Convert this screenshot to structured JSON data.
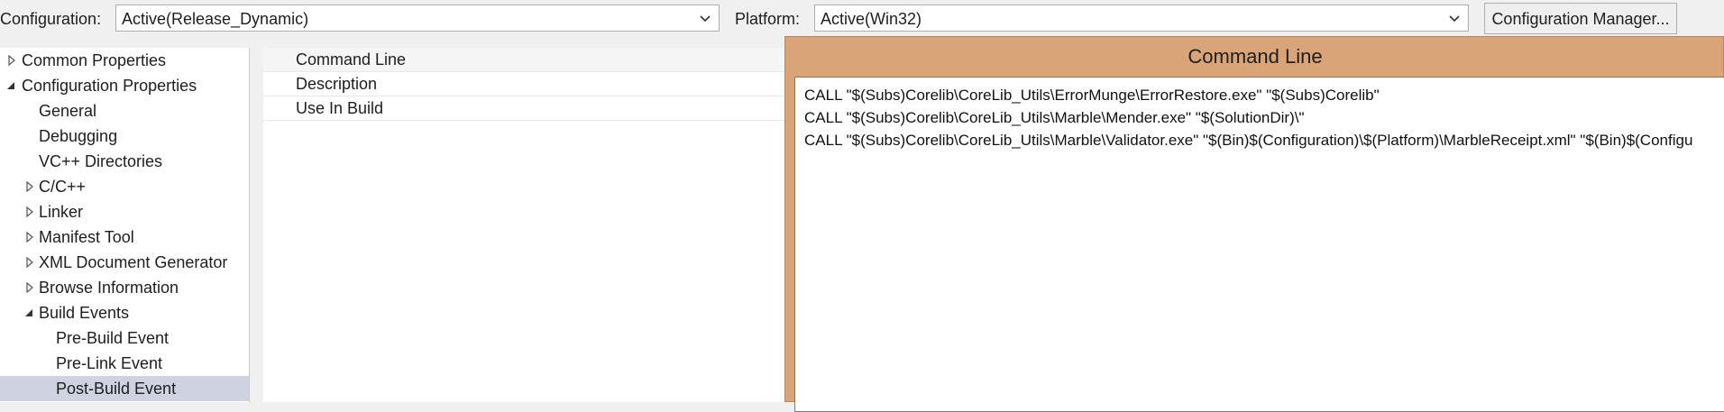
{
  "toolbar": {
    "configuration_label": "Configuration:",
    "configuration_value": "Active(Release_Dynamic)",
    "platform_label": "Platform:",
    "platform_value": "Active(Win32)",
    "config_manager_button": "Configuration Manager..."
  },
  "tree": {
    "items": [
      {
        "label": "Common Properties",
        "state": "collapsed"
      },
      {
        "label": "Configuration Properties",
        "state": "expanded"
      },
      {
        "label": "General",
        "state": "leaf"
      },
      {
        "label": "Debugging",
        "state": "leaf"
      },
      {
        "label": "VC++ Directories",
        "state": "leaf"
      },
      {
        "label": "C/C++",
        "state": "collapsed"
      },
      {
        "label": "Linker",
        "state": "collapsed"
      },
      {
        "label": "Manifest Tool",
        "state": "collapsed"
      },
      {
        "label": "XML Document Generator",
        "state": "collapsed"
      },
      {
        "label": "Browse Information",
        "state": "collapsed"
      },
      {
        "label": "Build Events",
        "state": "expanded"
      },
      {
        "label": "Pre-Build Event",
        "state": "leaf"
      },
      {
        "label": "Pre-Link Event",
        "state": "leaf"
      },
      {
        "label": "Post-Build Event",
        "state": "leaf",
        "selected": true
      }
    ]
  },
  "property_grid": {
    "rows": [
      {
        "label": "Command Line"
      },
      {
        "label": "Description"
      },
      {
        "label": "Use In Build"
      }
    ]
  },
  "dialog": {
    "title": "Command Line",
    "lines": [
      "CALL \"$(Subs)Corelib\\CoreLib_Utils\\ErrorMunge\\ErrorRestore.exe\" \"$(Subs)Corelib\"",
      "CALL \"$(Subs)Corelib\\CoreLib_Utils\\Marble\\Mender.exe\" \"$(SolutionDir)\\\"",
      "CALL \"$(Subs)Corelib\\CoreLib_Utils\\Marble\\Validator.exe\" \"$(Bin)$(Configuration)\\$(Platform)\\MarbleReceipt.xml\" \"$(Bin)$(Configu"
    ]
  },
  "colors": {
    "dialog_frame": "#d9a477",
    "selected_row": "#cfd3e1",
    "window_bg": "#f0f0f0"
  }
}
